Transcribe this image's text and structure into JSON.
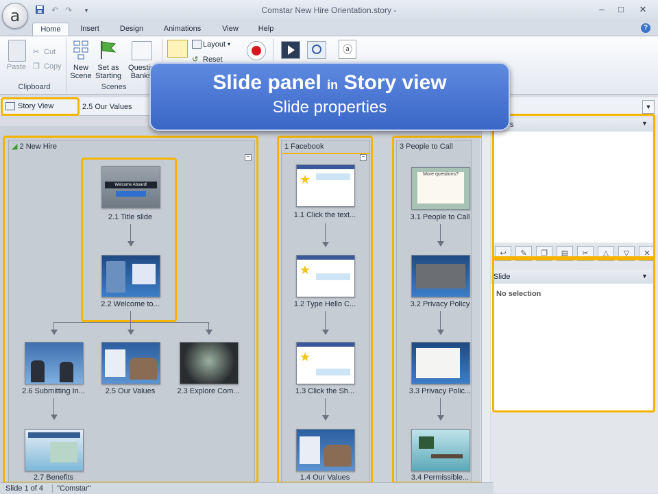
{
  "window": {
    "title": "Comstar New Hire Orientation.story -",
    "controls": {
      "minimize": "–",
      "maximize": "□",
      "close": "✕"
    }
  },
  "app_orb_letter": "a",
  "tabs": [
    {
      "label": "Home"
    },
    {
      "label": "Insert"
    },
    {
      "label": "Design"
    },
    {
      "label": "Animations"
    },
    {
      "label": "View"
    },
    {
      "label": "Help"
    }
  ],
  "ribbon": {
    "clipboard": {
      "paste": "Paste",
      "cut": "Cut",
      "copy": "Copy",
      "label": "Clipboard"
    },
    "scenes": {
      "new_scene_1": "New",
      "new_scene_2": "Scene",
      "set_starting_1": "Set as",
      "set_starting_2": "Starting",
      "question_banks_1": "Questio",
      "question_banks_2": "Banks",
      "label": "Scenes"
    },
    "slide": {
      "layout": "Layout",
      "reset": "Reset"
    }
  },
  "viewbar": {
    "story_view": "Story View",
    "breadcrumb": "2.5 Our Values"
  },
  "scenes": [
    {
      "title": "2 New Hire",
      "slides": [
        {
          "label": "2.1 Title slide"
        },
        {
          "label": "2.2 Welcome to..."
        },
        {
          "label": "2.6 Submitting In..."
        },
        {
          "label": "2.5 Our Values"
        },
        {
          "label": "2.3 Explore Com..."
        },
        {
          "label": "2.7 Benefits"
        }
      ]
    },
    {
      "title": "1 Facebook",
      "slides": [
        {
          "label": "1.1 Click the text..."
        },
        {
          "label": "1.2 Type Hello C..."
        },
        {
          "label": "1.3 Click the Sh..."
        },
        {
          "label": "1.4 Our Values"
        }
      ]
    },
    {
      "title": "3 People to Call",
      "slides": [
        {
          "label": "3.1 People to Call"
        },
        {
          "label": "3.2 Privacy Policy"
        },
        {
          "label": "3.3 Privacy Polic..."
        },
        {
          "label": "3.4 Permissible..."
        }
      ]
    }
  ],
  "thumb_text": {
    "welcome": "Welcome Aboard!",
    "questions": "More questions?"
  },
  "panels": {
    "triggers": {
      "title": "ggers"
    },
    "slide": {
      "title": "Slide",
      "empty": "No selection"
    }
  },
  "statusbar": {
    "slide": "Slide 1 of 4",
    "theme": "\"Comstar\""
  },
  "callout": {
    "title_a": "Slide panel",
    "title_in": "in",
    "title_b": "Story view",
    "subtitle": "Slide properties"
  },
  "colors": {
    "highlight": "#f5b400",
    "callout": "#4a76d4",
    "accent": "#2e6fd0"
  }
}
